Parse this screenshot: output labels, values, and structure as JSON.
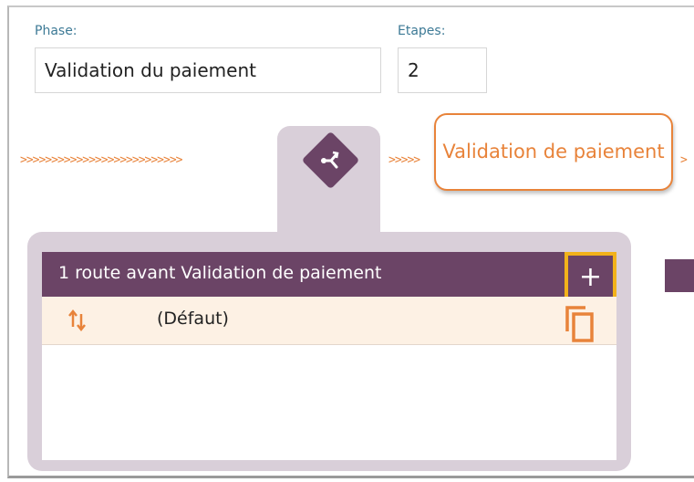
{
  "phase": {
    "label": "Phase:",
    "value": "Validation du paiement"
  },
  "etapes": {
    "label": "Etapes:",
    "value": "2"
  },
  "flow": {
    "arrows_left": ">>>>>>>>>>>>>>>>>>>>>>>>>>",
    "arrows_right": ">>>>>",
    "arrow_tail": ">",
    "node_icon": "branch-icon",
    "step_label": "Validation de paiement"
  },
  "routes_panel": {
    "title": "1 route avant Validation de paiement",
    "add_label": "+",
    "rows": [
      {
        "label": "(Défaut)",
        "sort_icon": "sort-arrows-icon",
        "action_icon": "copy-icon"
      }
    ]
  },
  "colors": {
    "accent": "#6b4466",
    "orange": "#e8833a",
    "highlight": "#f2b21b",
    "label": "#3d7a96"
  }
}
